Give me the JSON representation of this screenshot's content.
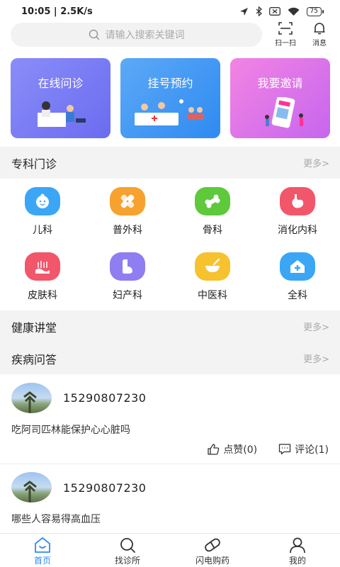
{
  "status": {
    "time": "10:05",
    "speed": "2.5K/s",
    "battery": "75"
  },
  "search": {
    "placeholder": "请输入搜索关键词"
  },
  "top_actions": {
    "scan_label": "扫一扫",
    "message_label": "消息"
  },
  "banners": [
    {
      "label": "在线问诊",
      "color": "#7b7ef4"
    },
    {
      "label": "挂号预约",
      "color": "#3d94f3"
    },
    {
      "label": "我要邀请",
      "color": "#d874ea"
    }
  ],
  "specialty": {
    "title": "专科门诊",
    "more": "更多>",
    "items": [
      {
        "label": "儿科",
        "icon": "baby-face-icon",
        "color": "#3aa6f5"
      },
      {
        "label": "普外科",
        "icon": "bandage-icon",
        "color": "#f7a12f"
      },
      {
        "label": "骨科",
        "icon": "bone-icon",
        "color": "#5ec93b"
      },
      {
        "label": "消化内科",
        "icon": "stomach-icon",
        "color": "#f2566b"
      },
      {
        "label": "皮肤科",
        "icon": "skin-icon",
        "color": "#f2566b"
      },
      {
        "label": "妇产科",
        "icon": "uterus-icon",
        "color": "#8f7df2"
      },
      {
        "label": "中医科",
        "icon": "herb-bowl-icon",
        "color": "#f7c22f"
      },
      {
        "label": "全科",
        "icon": "medical-kit-icon",
        "color": "#3aa6f5"
      }
    ]
  },
  "lecture": {
    "title": "健康讲堂",
    "more": "更多>"
  },
  "qa": {
    "title": "疾病问答",
    "more": "更多>",
    "posts": [
      {
        "user": "15290807230",
        "question": "吃阿司匹林能保护心心脏吗",
        "like_label": "点赞(0)",
        "comment_label": "评论(1)"
      },
      {
        "user": "15290807230",
        "question": "哪些人容易得高血压"
      }
    ]
  },
  "tabbar": [
    {
      "label": "首页",
      "icon": "home-icon",
      "active": true
    },
    {
      "label": "找诊所",
      "icon": "search-icon",
      "active": false
    },
    {
      "label": "闪电购药",
      "icon": "capsule-icon",
      "active": false
    },
    {
      "label": "我的",
      "icon": "user-icon",
      "active": false
    }
  ]
}
